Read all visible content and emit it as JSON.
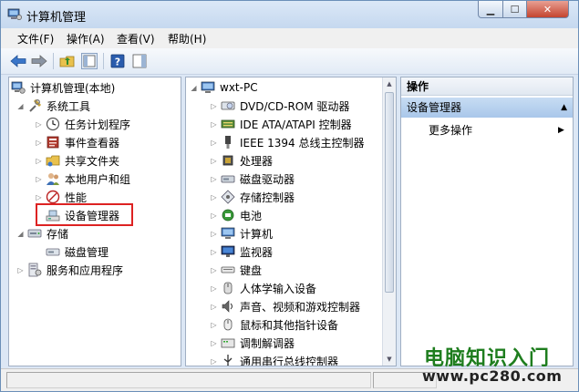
{
  "window": {
    "title": "计算机管理"
  },
  "window_controls": {
    "minimize": "▁",
    "maximize": "☐",
    "close": "✕"
  },
  "menu": [
    {
      "label": "文件(F)"
    },
    {
      "label": "操作(A)"
    },
    {
      "label": "查看(V)"
    },
    {
      "label": "帮助(H)"
    }
  ],
  "toolbar": [
    "back-arrow-icon",
    "forward-arrow-icon",
    "up-folder-icon",
    "show-hide-tree-icon",
    "help-icon",
    "show-hide-action-pane-icon"
  ],
  "left_tree": {
    "root": "计算机管理(本地)",
    "system_tools": "系统工具",
    "task_scheduler": "任务计划程序",
    "event_viewer": "事件查看器",
    "shared_folders": "共享文件夹",
    "local_users": "本地用户和组",
    "performance": "性能",
    "device_manager": "设备管理器",
    "storage": "存储",
    "disk_management": "磁盘管理",
    "services": "服务和应用程序"
  },
  "device_tree": {
    "root": "wxt-PC",
    "items": [
      {
        "label": "DVD/CD-ROM 驱动器",
        "icon": "dvd-drive-icon"
      },
      {
        "label": "IDE ATA/ATAPI 控制器",
        "icon": "ide-controller-icon"
      },
      {
        "label": "IEEE 1394 总线主控制器",
        "icon": "ieee1394-icon"
      },
      {
        "label": "处理器",
        "icon": "processor-icon"
      },
      {
        "label": "磁盘驱动器",
        "icon": "disk-drive-icon"
      },
      {
        "label": "存储控制器",
        "icon": "storage-controller-icon"
      },
      {
        "label": "电池",
        "icon": "battery-icon"
      },
      {
        "label": "计算机",
        "icon": "computer-icon"
      },
      {
        "label": "监视器",
        "icon": "monitor-icon"
      },
      {
        "label": "键盘",
        "icon": "keyboard-icon"
      },
      {
        "label": "人体学输入设备",
        "icon": "hid-icon"
      },
      {
        "label": "声音、视频和游戏控制器",
        "icon": "sound-icon"
      },
      {
        "label": "鼠标和其他指针设备",
        "icon": "mouse-icon"
      },
      {
        "label": "调制解调器",
        "icon": "modem-icon"
      },
      {
        "label": "通用串行总线控制器",
        "icon": "usb-icon"
      }
    ]
  },
  "actions": {
    "header": "操作",
    "selected": "设备管理器",
    "more": "更多操作"
  },
  "watermark": {
    "title": "电脑知识入门",
    "url": "www.pc280.com"
  },
  "colors": {
    "highlight_box": "#dd2222",
    "watermark_green": "#1e7d1e",
    "selection": "#a9c7ea"
  }
}
